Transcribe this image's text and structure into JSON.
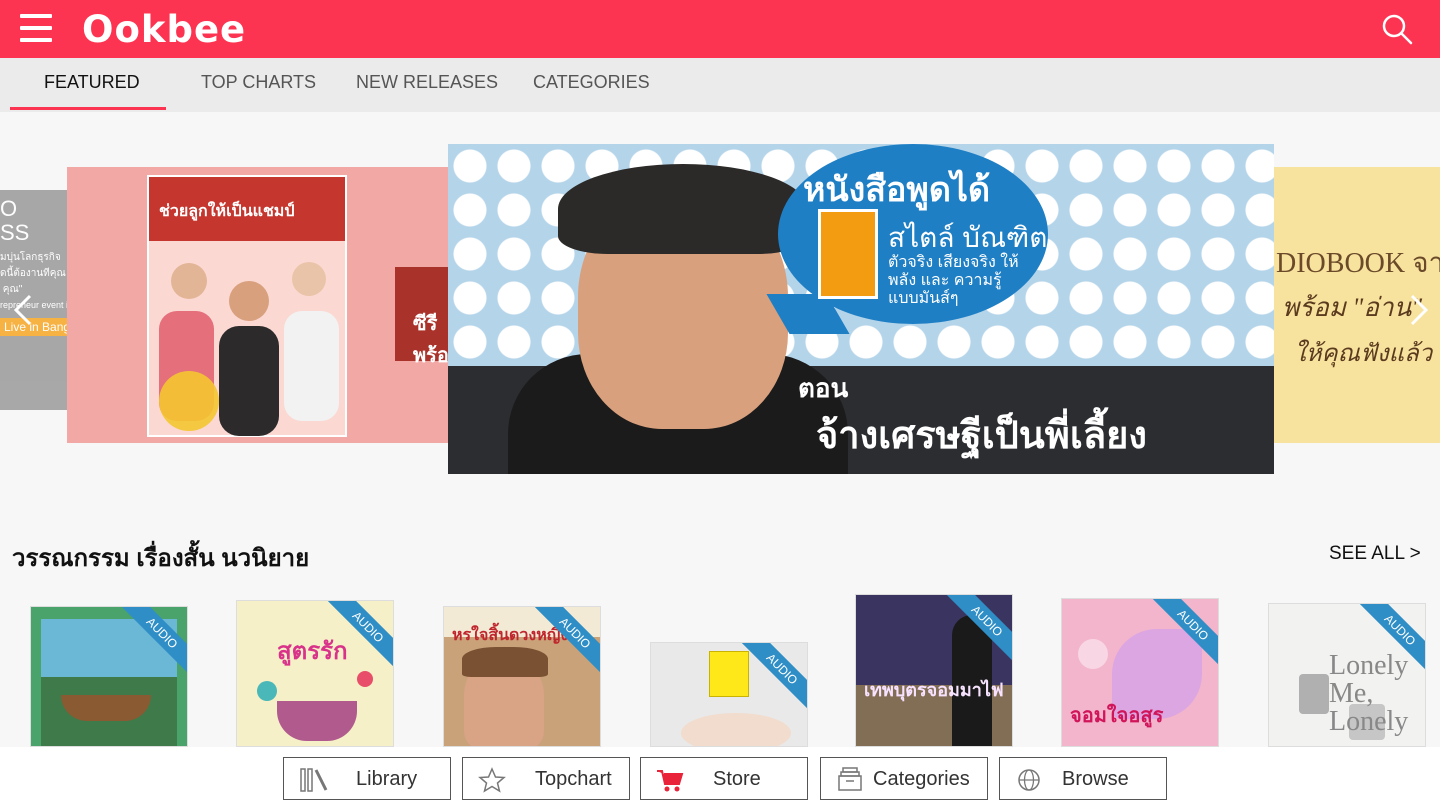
{
  "app": {
    "logo": "Ookbee"
  },
  "tabs": [
    {
      "label": "FEATURED",
      "active": true
    },
    {
      "label": "TOP CHARTS"
    },
    {
      "label": "NEW RELEASES"
    },
    {
      "label": "CATEGORIES"
    }
  ],
  "carousel": {
    "far_left": {
      "lines": [
        "O",
        "SS",
        "มบุ่นโลกธุรกิจ",
        "ดนี้ต้องานทีคุณ",
        "ุ คุณ\"",
        "repreneur event in 2015",
        "Live in Bangkok"
      ]
    },
    "left": {
      "cover_title": "ช่วยลูกให้เป็นแชมป์",
      "side_text": "ซีรี พร้อ"
    },
    "main": {
      "bubble_title": "หนังสือพูดได้",
      "bubble_subtitle": "สไตล์ บัณฑิต",
      "bubble_small": "ตัวจริง เสียงจริง ให้พลัง และ ความรู้ แบบมันส์ๆ",
      "episode_label": "ตอน",
      "episode_title": "จ้างเศรษฐีเป็นพี่เลี้ยง"
    },
    "right": {
      "line1": "DIOBOOK จาก",
      "line2": "พร้อม \"อ่าน\"",
      "line3": "ให้คุณฟังแล้ว"
    }
  },
  "section": {
    "title": "วรรณกรรม เรื่องสั้น นวนิยาย",
    "see_all": "SEE ALL >"
  },
  "books": [
    {
      "badge": "AUDIO",
      "cover_text": "",
      "color": "#4aa36a"
    },
    {
      "badge": "AUDIO",
      "cover_text": "สูตรรัก",
      "color": "#f6f0c8"
    },
    {
      "badge": "AUDIO",
      "cover_text": "หรใจสิ้นดวงหญิง",
      "color": "#c9a27a"
    },
    {
      "badge": "AUDIO",
      "cover_text": "",
      "color": "#e9e9e9"
    },
    {
      "badge": "AUDIO",
      "cover_text": "เทพบุตรจอมมาไฟ",
      "color": "#3a3560"
    },
    {
      "badge": "AUDIO",
      "cover_text": "จอมใจอสูร",
      "color": "#f3b5cb"
    },
    {
      "badge": "AUDIO",
      "cover_text": "Lonely Me, Lonely",
      "color": "#f2f2f0"
    }
  ],
  "bottom_nav": [
    {
      "label": "Library",
      "icon": "library-icon"
    },
    {
      "label": "Topchart",
      "icon": "star-icon"
    },
    {
      "label": "Store",
      "icon": "cart-icon"
    },
    {
      "label": "Categories",
      "icon": "categories-icon"
    },
    {
      "label": "Browse",
      "icon": "globe-icon"
    }
  ],
  "colors": {
    "brand": "#fc3451",
    "badge": "#2f8ec6"
  }
}
